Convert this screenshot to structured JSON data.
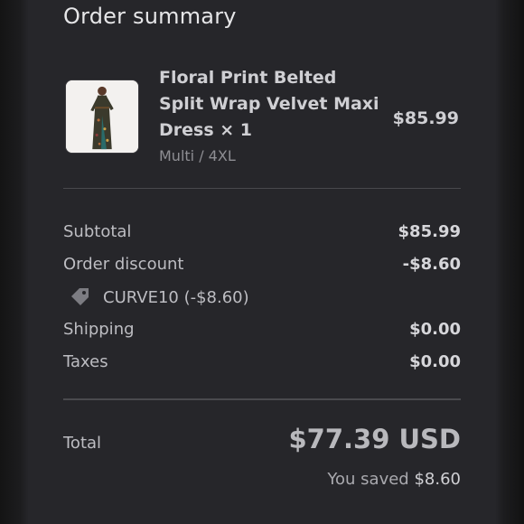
{
  "header": {
    "title": "Order summary"
  },
  "product": {
    "name": "Floral Print Belted Split Wrap Velvet Maxi Dress × 1",
    "variant": "Multi / 4XL",
    "price": "$85.99"
  },
  "summary": {
    "subtotal_label": "Subtotal",
    "subtotal_value": "$85.99",
    "discount_label": "Order discount",
    "discount_value": "-$8.60",
    "discount_code": "CURVE10 (-$8.60)",
    "shipping_label": "Shipping",
    "shipping_value": "$0.00",
    "taxes_label": "Taxes",
    "taxes_value": "$0.00"
  },
  "total": {
    "label": "Total",
    "amount": "$77.39 USD",
    "saved_label": "You saved",
    "saved_amount": "$8.60"
  },
  "icons": {
    "discount_tag": "tag-icon",
    "product_image": "dress-thumbnail"
  }
}
